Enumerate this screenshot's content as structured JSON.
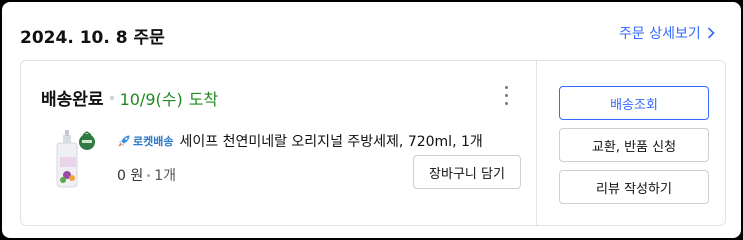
{
  "order": {
    "date_title": "2024. 10. 8 주문",
    "detail_link": "주문 상세보기"
  },
  "shipment": {
    "status": "배송완료",
    "arrival_date": "10/9(수)",
    "arrival_suffix": "도착"
  },
  "product": {
    "delivery_badge": "로켓배송",
    "name": "세이프 천연미네랄 오리지널 주방세제, 720ml, 1개",
    "price": "0 원",
    "quantity": "1개",
    "add_to_cart_label": "장바구니 담기"
  },
  "actions": {
    "track_label": "배송조회",
    "exchange_return_label": "교환, 반품 신청",
    "review_label": "리뷰 작성하기"
  },
  "colors": {
    "accent": "#346aff",
    "arrival": "#1f8a1f",
    "rocket": "#2c7ac9"
  }
}
